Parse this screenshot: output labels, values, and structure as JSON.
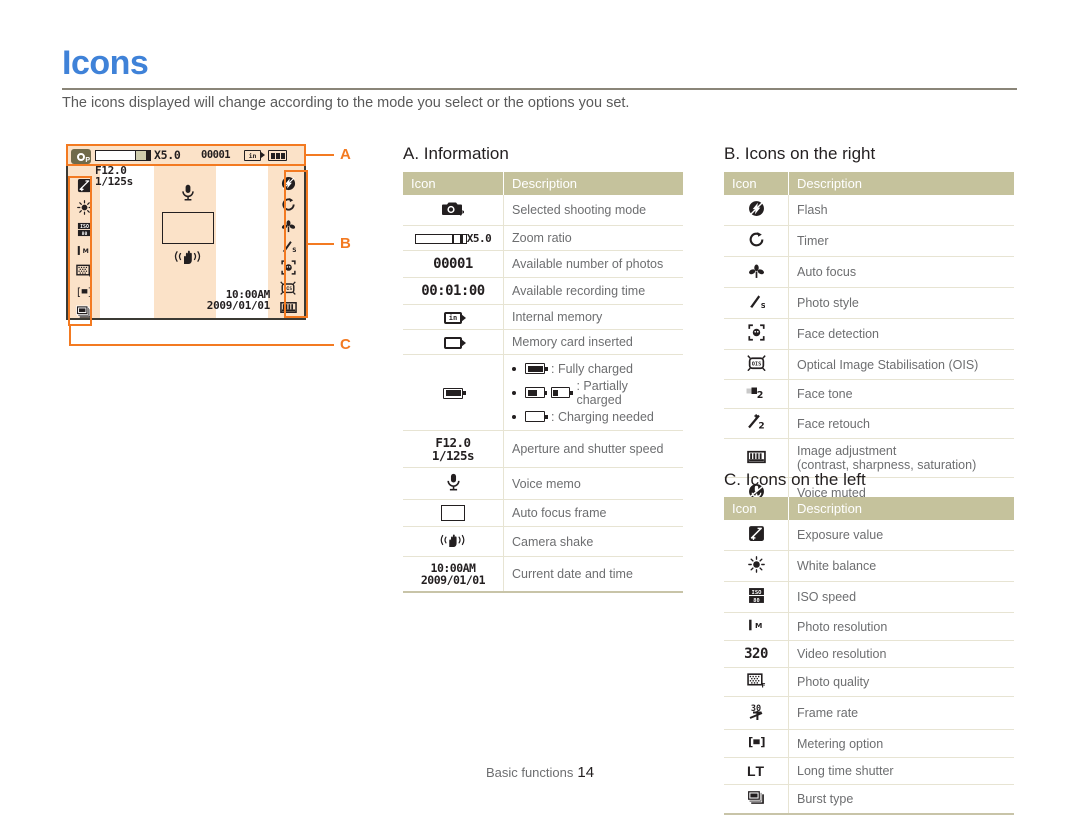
{
  "page": {
    "title": "Icons",
    "intro": "The icons displayed will change according to the mode you select or the options you set.",
    "footer_label": "Basic functions",
    "footer_page": "14",
    "accent_title_color": "#3f82d8",
    "accent_callout_color": "#f37a21",
    "table_header_color": "#c5c29c"
  },
  "lcd": {
    "zoom_ratio": "X5.0",
    "shots_remaining": "00001",
    "memory_icon": "in",
    "aperture": "F12.0",
    "shutter": "1/125s",
    "time": "10:00AM",
    "date": "2009/01/01",
    "left_icons": [
      "exposure-value-icon",
      "white-balance-icon",
      "iso-speed-icon",
      "photo-resolution-icon",
      "photo-quality-icon",
      "metering-option-icon",
      "burst-type-icon"
    ],
    "right_icons": [
      "flash-icon",
      "timer-icon",
      "auto-focus-icon",
      "photo-style-icon",
      "face-detection-icon",
      "ois-icon",
      "image-adjustment-icon"
    ],
    "center_icons": [
      "voice-memo-icon",
      "auto-focus-frame",
      "camera-shake-icon"
    ],
    "callouts": [
      {
        "label": "A"
      },
      {
        "label": "B"
      },
      {
        "label": "C"
      }
    ]
  },
  "sections": {
    "a": {
      "title": "A. Information",
      "columns": [
        "Icon",
        "Description"
      ],
      "rows": [
        {
          "icon_name": "shooting-mode-icon",
          "icon_text": "",
          "description": "Selected shooting mode"
        },
        {
          "icon_name": "zoom-ratio-icon",
          "icon_text": "X5.0",
          "description": "Zoom ratio"
        },
        {
          "icon_name": "photos-count-icon",
          "icon_text": "00001",
          "description": "Available number of photos"
        },
        {
          "icon_name": "recording-time-icon",
          "icon_text": "00:01:00",
          "description": "Available recording time"
        },
        {
          "icon_name": "internal-memory-icon",
          "icon_text": "in",
          "description": "Internal memory"
        },
        {
          "icon_name": "memory-card-icon",
          "icon_text": "",
          "description": "Memory card inserted"
        },
        {
          "icon_name": "battery-icon",
          "icon_text": "",
          "description": "",
          "battery_items": [
            "Fully charged",
            "Partially charged",
            "Charging needed"
          ]
        },
        {
          "icon_name": "aperture-shutter-icon",
          "icon_text": "F12.0 1/125s",
          "description": "Aperture and shutter speed"
        },
        {
          "icon_name": "voice-memo-icon",
          "icon_text": "",
          "description": "Voice memo"
        },
        {
          "icon_name": "auto-focus-frame-icon",
          "icon_text": "",
          "description": "Auto focus frame"
        },
        {
          "icon_name": "camera-shake-icon",
          "icon_text": "",
          "description": "Camera shake"
        },
        {
          "icon_name": "date-time-icon",
          "icon_text": "10:00 AM 2009/01/01",
          "description": "Current date and time"
        }
      ]
    },
    "b": {
      "title": "B. Icons on the right",
      "columns": [
        "Icon",
        "Description"
      ],
      "rows": [
        {
          "icon_name": "flash-icon",
          "description": "Flash"
        },
        {
          "icon_name": "timer-icon",
          "description": "Timer"
        },
        {
          "icon_name": "auto-focus-icon",
          "description": "Auto focus"
        },
        {
          "icon_name": "photo-style-icon",
          "description": "Photo style"
        },
        {
          "icon_name": "face-detection-icon",
          "description": "Face detection"
        },
        {
          "icon_name": "ois-icon",
          "description": "Optical Image Stabilisation (OIS)"
        },
        {
          "icon_name": "face-tone-icon",
          "description": "Face tone"
        },
        {
          "icon_name": "face-retouch-icon",
          "description": "Face retouch"
        },
        {
          "icon_name": "image-adjustment-icon",
          "description": "Image adjustment",
          "description2": "(contrast, sharpness, saturation)"
        },
        {
          "icon_name": "voice-muted-icon",
          "description": "Voice muted"
        }
      ]
    },
    "c": {
      "title": "C. Icons on the left",
      "columns": [
        "Icon",
        "Description"
      ],
      "rows": [
        {
          "icon_name": "exposure-value-icon",
          "description": "Exposure value"
        },
        {
          "icon_name": "white-balance-icon",
          "description": "White balance"
        },
        {
          "icon_name": "iso-speed-icon",
          "description": "ISO speed"
        },
        {
          "icon_name": "photo-resolution-icon",
          "description": "Photo resolution"
        },
        {
          "icon_name": "video-resolution-icon",
          "icon_text": "320",
          "description": "Video resolution"
        },
        {
          "icon_name": "photo-quality-icon",
          "description": "Photo quality"
        },
        {
          "icon_name": "frame-rate-icon",
          "icon_text": "30",
          "description": "Frame rate"
        },
        {
          "icon_name": "metering-option-icon",
          "icon_text": "[■]",
          "description": "Metering option"
        },
        {
          "icon_name": "long-time-shutter-icon",
          "icon_text": "LT",
          "description": "Long time shutter"
        },
        {
          "icon_name": "burst-type-icon",
          "description": "Burst type"
        }
      ]
    }
  }
}
